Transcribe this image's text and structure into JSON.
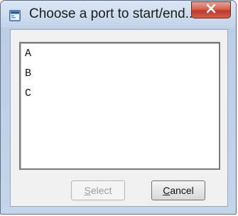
{
  "window": {
    "title": "Choose a port to start/end...",
    "icon": "app-window-icon",
    "close_icon": "close-x-icon"
  },
  "ports_list": {
    "items": [
      "A",
      "B",
      "C"
    ]
  },
  "buttons": {
    "select": {
      "mnemonic": "S",
      "rest": "elect",
      "enabled": false
    },
    "cancel": {
      "mnemonic": "C",
      "rest": "ancel",
      "enabled": true
    }
  },
  "colors": {
    "title_bar": "#c3d3e8",
    "close_button": "#c0382a",
    "client_background": "#f0f0f0",
    "disabled_text": "#9d9d9d"
  }
}
